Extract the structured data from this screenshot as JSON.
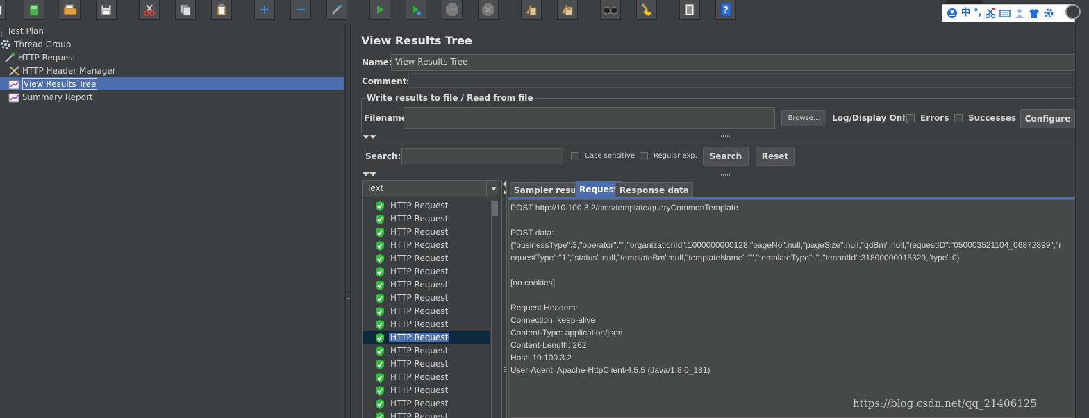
{
  "toolbar": {
    "buttons": [
      "open-template-icon",
      "new-icon",
      "open-icon",
      "save-icon",
      "cut-icon",
      "copy-icon",
      "paste-icon",
      "expand-icon",
      "collapse-icon",
      "toggle-icon",
      "start-icon",
      "start-no-pauses-icon",
      "stop-icon",
      "shutdown-icon",
      "clear-icon",
      "clear-all-icon",
      "search-icon",
      "reset-search-icon",
      "function-helper-icon",
      "help-icon"
    ],
    "colors": {
      "start": "#2fae38",
      "stop": "#7a7a7a",
      "add": "#3d8fe0",
      "help": "#2e6fd8"
    }
  },
  "ime": {
    "items": [
      "user-icon",
      "中",
      "°,",
      "scissors-icon",
      "keyboard-icon",
      "person-icon",
      "shirt-icon",
      "gear-icon"
    ]
  },
  "tree": {
    "items": [
      {
        "label": "Test Plan",
        "icon": "test-plan-icon"
      },
      {
        "label": "Thread Group",
        "icon": "gear-icon"
      },
      {
        "label": "HTTP Request",
        "icon": "pipette-icon"
      },
      {
        "label": "HTTP Header Manager",
        "icon": "wrench-icon"
      },
      {
        "label": "View Results Tree",
        "icon": "chart-icon",
        "selected": true
      },
      {
        "label": "Summary Report",
        "icon": "chart-icon"
      }
    ],
    "selection_color": "#4b6eaf"
  },
  "panel": {
    "title": "View Results Tree",
    "name_label": "Name:",
    "name_value": "View Results Tree",
    "comments_label": "Comments:",
    "write_group_label": "Write results to file / Read from file",
    "filename_label": "Filename",
    "filename_value": "",
    "browse_label": "Browse...",
    "log_display_label": "Log/Display Only:",
    "errors_label": "Errors",
    "successes_label": "Successes",
    "configure_label": "Configure",
    "search_label": "Search:",
    "search_value": "",
    "case_sensitive_label": "Case sensitive",
    "regular_exp_label": "Regular exp.",
    "search_button": "Search",
    "reset_button": "Reset"
  },
  "results": {
    "renderer": "Text",
    "rows": [
      "HTTP Request",
      "HTTP Request",
      "HTTP Request",
      "HTTP Request",
      "HTTP Request",
      "HTTP Request",
      "HTTP Request",
      "HTTP Request",
      "HTTP Request",
      "HTTP Request",
      "HTTP Request",
      "HTTP Request",
      "HTTP Request",
      "HTTP Request",
      "HTTP Request",
      "HTTP Request",
      "HTTP Request"
    ],
    "selected_index": 10,
    "status_color": "#2fbf3a"
  },
  "tabs": [
    {
      "label": "Sampler result",
      "active": false
    },
    {
      "label": "Request",
      "active": true
    },
    {
      "label": "Response data",
      "active": false
    }
  ],
  "request": {
    "lines": [
      "POST http://10.100.3.2/cms/template/queryCommonTemplate",
      "",
      "POST data:",
      "{\"businessType\":3,\"operator\":\"\",\"organizationId\":1000000000128,\"pageNo\":null,\"pageSize\":null,\"qdBm\":null,\"requestID\":\"050003521104_06872899\",\"r",
      "equestType\":\"1\",\"status\":null,\"templateBm\":null,\"templateName\":\"\",\"templateType\":\"\",\"tenantId\":31800000015329,\"type\":0}",
      "",
      "[no cookies]",
      "",
      "Request Headers:",
      "Connection: keep-alive",
      "Content-Type: application/json",
      "Content-Length: 262",
      "Host: 10.100.3.2",
      "User-Agent: Apache-HttpClient/4.5.5 (Java/1.8.0_181)"
    ]
  },
  "watermark": "https://blog.csdn.net/qq_21406125"
}
